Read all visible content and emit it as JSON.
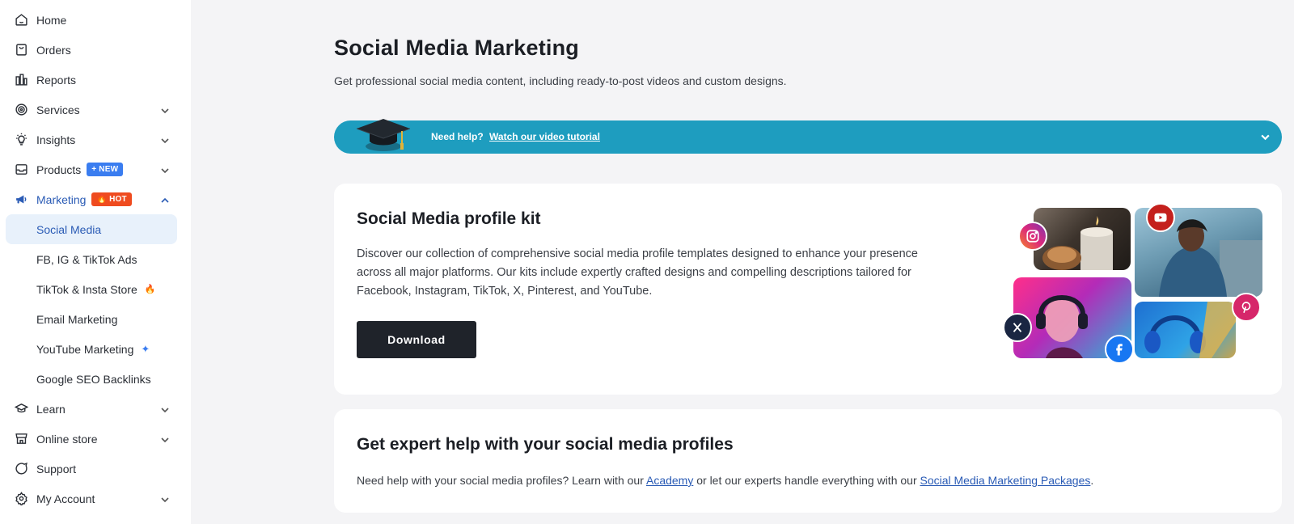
{
  "sidebar": {
    "items": [
      {
        "label": "Home",
        "icon": "home-icon"
      },
      {
        "label": "Orders",
        "icon": "orders-icon"
      },
      {
        "label": "Reports",
        "icon": "reports-icon"
      },
      {
        "label": "Services",
        "icon": "target-icon",
        "expandable": true
      },
      {
        "label": "Insights",
        "icon": "lightbulb-icon",
        "expandable": true
      },
      {
        "label": "Products",
        "icon": "inbox-icon",
        "expandable": true,
        "badge": "NEW"
      },
      {
        "label": "Marketing",
        "icon": "megaphone-icon",
        "expandable": true,
        "expanded": true,
        "badge": "HOT"
      },
      {
        "label": "Learn",
        "icon": "graduation-cap-icon",
        "expandable": true
      },
      {
        "label": "Online store",
        "icon": "store-icon",
        "expandable": true
      },
      {
        "label": "Support",
        "icon": "chat-icon"
      },
      {
        "label": "My Account",
        "icon": "gear-icon",
        "expandable": true
      }
    ],
    "marketing_sub": [
      {
        "label": "Social Media",
        "active": true
      },
      {
        "label": "FB, IG & TikTok Ads"
      },
      {
        "label": "TikTok & Insta Store",
        "icon": "flame-icon"
      },
      {
        "label": "Email Marketing"
      },
      {
        "label": "YouTube Marketing",
        "icon": "sparkle-icon"
      },
      {
        "label": "Google SEO Backlinks"
      }
    ],
    "badges": {
      "new": "NEW",
      "hot": "HOT"
    }
  },
  "page": {
    "title": "Social Media Marketing",
    "subtitle": "Get professional social media content, including ready-to-post videos and custom designs."
  },
  "help_bar": {
    "prefix": "Need help?",
    "link": "Watch our video tutorial"
  },
  "kit_card": {
    "title": "Social Media profile kit",
    "description": "Discover our collection of comprehensive social media profile templates designed to enhance your presence across all major platforms. Our kits include expertly crafted designs and compelling descriptions tailored for Facebook, Instagram, TikTok, X, Pinterest, and YouTube.",
    "button": "Download"
  },
  "expert_card": {
    "title": "Get expert help with your social media profiles",
    "text_before": "Need help with your social media profiles? Learn with our ",
    "link_academy": "Academy",
    "text_middle": " or let our experts handle everything with our ",
    "link_packages": "Social Media Marketing Packages",
    "text_after": "."
  },
  "colors": {
    "accent": "#2a5bb5",
    "help_bar": "#1e9dbf",
    "badge_new": "#3a7df0",
    "badge_hot": "#ef4b1f",
    "button_dark": "#1f232a"
  }
}
